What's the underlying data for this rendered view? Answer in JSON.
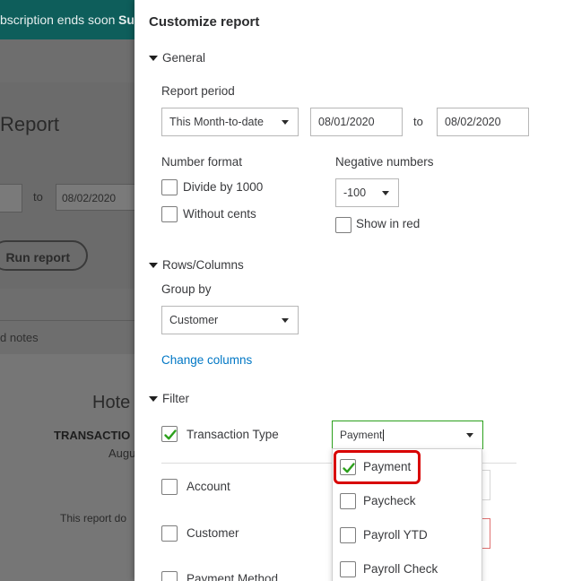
{
  "background": {
    "banner_text_a": "bscription ends soon",
    "banner_text_b": "Su",
    "title": "Report",
    "to_label": "to",
    "date_end": "08/02/2020",
    "run_button": "Run report",
    "notes": "d notes",
    "company": "Hote",
    "report_type": "TRANSACTIO",
    "period": "Augu",
    "note": "This report do"
  },
  "panel": {
    "title": "Customize report",
    "general": {
      "heading": "General",
      "report_period_label": "Report period",
      "period_select": "This Month-to-date",
      "date_from": "08/01/2020",
      "to_label": "to",
      "date_to": "08/02/2020",
      "number_format_label": "Number format",
      "divide_label": "Divide by 1000",
      "cents_label": "Without cents",
      "negative_label": "Negative numbers",
      "negative_select": "-100",
      "show_red_label": "Show in red"
    },
    "rows_columns": {
      "heading": "Rows/Columns",
      "group_by_label": "Group by",
      "group_by_select": "Customer",
      "change_columns": "Change columns"
    },
    "filter": {
      "heading": "Filter",
      "transaction_type_label": "Transaction Type",
      "transaction_type_value": "Payment",
      "account_label": "Account",
      "customer_label": "Customer",
      "payment_method_label": "Payment Method",
      "options": [
        "Payment",
        "Paycheck",
        "Payroll YTD",
        "Payroll Check"
      ]
    }
  },
  "colors": {
    "accent_green": "#2ca01c",
    "link_blue": "#0077c5",
    "highlight_red": "#d80000"
  }
}
